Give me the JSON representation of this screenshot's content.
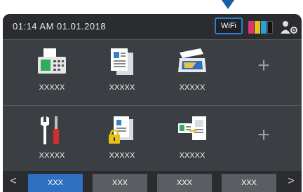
{
  "status": {
    "datetime": "01:14  AM   01.01.2018",
    "wifi_label": "WiFi",
    "ink_colors": [
      "#e2317a",
      "#e6c21a",
      "#2a9fd8",
      "#111111"
    ]
  },
  "tiles": [
    {
      "label": "XXXXX",
      "icon": "fax-icon"
    },
    {
      "label": "XXXXX",
      "icon": "copy-document-icon"
    },
    {
      "label": "XXXXX",
      "icon": "scanner-icon"
    },
    {
      "label": "XXXXX",
      "icon": "tools-icon"
    },
    {
      "label": "XXXXX",
      "icon": "secure-print-icon"
    },
    {
      "label": "XXXXX",
      "icon": "id-card-copy-icon"
    }
  ],
  "add_shortcut_label": "+",
  "tabs": [
    {
      "label": "XXX",
      "active": true
    },
    {
      "label": "XXX",
      "active": false
    },
    {
      "label": "XXX",
      "active": false
    },
    {
      "label": "XXX",
      "active": false
    }
  ],
  "nav": {
    "prev": "<",
    "next": ">"
  },
  "accent_color": "#2f6fc0"
}
